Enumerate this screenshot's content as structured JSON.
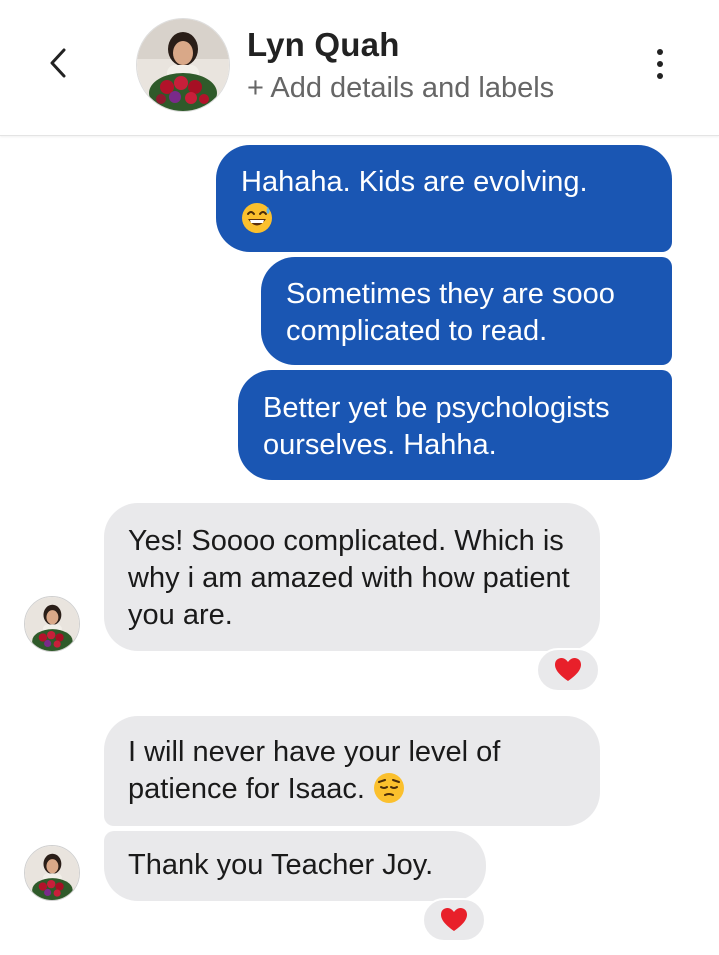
{
  "header": {
    "contact_name": "Lyn Quah",
    "add_details": "+ Add details and labels",
    "back_icon": "chevron-left-icon",
    "more_icon": "more-vertical-icon"
  },
  "messages": [
    {
      "direction": "sent",
      "text": "Hahaha. Kids are evolving.",
      "emoji": "grinning-sweat-emoji"
    },
    {
      "direction": "sent",
      "text": "Sometimes they are sooo complicated to read."
    },
    {
      "direction": "sent",
      "text": "Better yet be psychologists ourselves. Hahha."
    },
    {
      "direction": "received",
      "text": "Yes! Soooo complicated. Which is why i am amazed with how patient you are.",
      "reaction": "red-heart"
    },
    {
      "direction": "received",
      "text": "I will never have your level of patience for Isaac.",
      "emoji": "pensive-face-emoji"
    },
    {
      "direction": "received",
      "text": "Thank you Teacher Joy.",
      "reaction": "red-heart"
    }
  ],
  "colors": {
    "sent_bubble": "#1a56b3",
    "received_bubble": "#e9e9eb",
    "heart": "#e8202a"
  }
}
